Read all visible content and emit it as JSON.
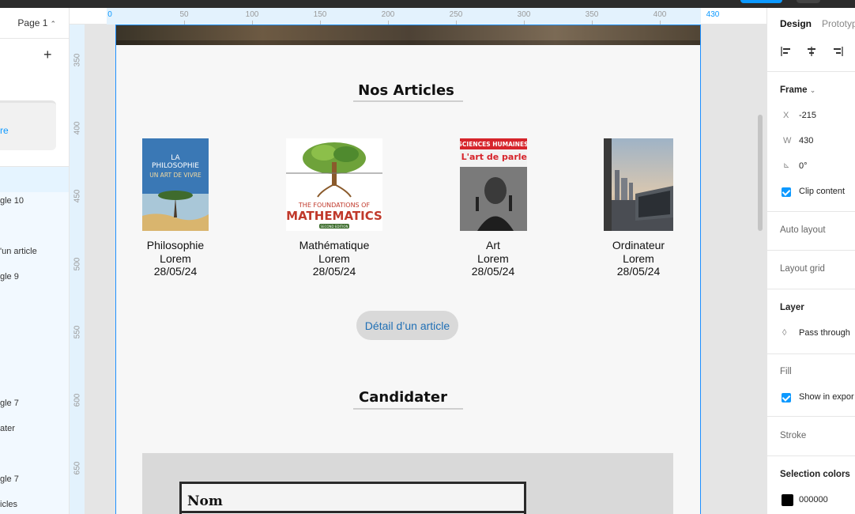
{
  "leftpanel": {
    "page_select": "Page 1",
    "page_card_label": "re",
    "layers": [
      "gle 10",
      "'un article",
      "gle 9",
      "gle 7",
      "ater",
      "gle 7",
      "icles"
    ]
  },
  "rulers": {
    "top_labels": [
      "0",
      "50",
      "100",
      "150",
      "200",
      "250",
      "300",
      "350",
      "400",
      "430"
    ],
    "left_labels": [
      "350",
      "400",
      "450",
      "500",
      "550",
      "600",
      "650"
    ]
  },
  "page": {
    "articles_title": "Nos Articles",
    "articles": [
      {
        "title": "Philosophie",
        "subtitle": "Lorem",
        "date": "28/05/24",
        "cover_text": [
          "LA",
          "PHILOSOPHIE",
          "UN ART DE VIVRE"
        ]
      },
      {
        "title": "Mathématique",
        "subtitle": "Lorem",
        "date": "28/05/24",
        "cover_text": [
          "THE FOUNDATIONS OF",
          "MATHEMATICS",
          "SECOND EDITION"
        ]
      },
      {
        "title": "Art",
        "subtitle": "Lorem",
        "date": "28/05/24",
        "cover_text": [
          "SCIENCES HUMAINES",
          "L'art de parler"
        ]
      },
      {
        "title": "Ordinateur",
        "subtitle": "Lorem",
        "date": "28/05/24",
        "cover_text": []
      }
    ],
    "detail_button": "Détail d’un article",
    "candidater_title": "Candidater",
    "form_field_label": "Nom"
  },
  "rightpanel": {
    "tabs": [
      "Design",
      "Prototyp"
    ],
    "frame_label": "Frame",
    "x_label": "X",
    "x_value": "-215",
    "w_label": "W",
    "w_value": "430",
    "rotation_value": "0°",
    "clip_content": "Clip content",
    "auto_layout": "Auto layout",
    "layout_grid": "Layout grid",
    "layer_title": "Layer",
    "layer_blend": "Pass through",
    "fill_title": "Fill",
    "show_in_exports": "Show in expor",
    "stroke_title": "Stroke",
    "selection_colors_title": "Selection colors",
    "selection_color_hex": "000000"
  },
  "colors": {
    "accent": "#0d99ff",
    "frame_border": "#1e90ff",
    "button_bg": "#d9d9d9",
    "button_text": "#1f6fb5"
  }
}
